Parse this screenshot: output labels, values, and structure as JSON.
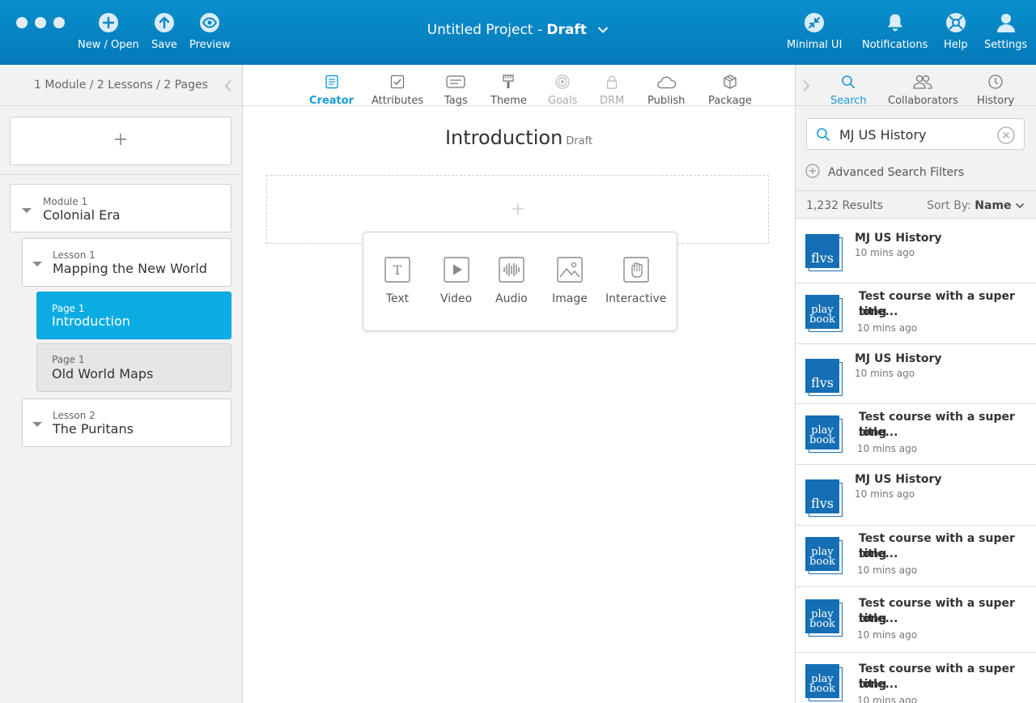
{
  "window": {
    "title": "Untitled Project",
    "title_sep": " - ",
    "status": "Draft"
  },
  "toolbar": {
    "new_open": "New / Open",
    "save": "Save",
    "preview": "Preview",
    "minimal_ui": "Minimal UI",
    "notifications": "Notifications",
    "help": "Help",
    "settings": "Settings"
  },
  "outline": {
    "summary": "1 Module / 2 Lessons / 2 Pages",
    "items": [
      {
        "kind": "Module 1",
        "name": "Colonial Era"
      },
      {
        "kind": "Lesson 1",
        "name": "Mapping the New World"
      },
      {
        "kind": "Page 1",
        "name": "Introduction"
      },
      {
        "kind": "Page 1",
        "name": "Old World Maps"
      },
      {
        "kind": "Lesson 2",
        "name": "The Puritans"
      }
    ]
  },
  "tabs": [
    {
      "label": "Creator"
    },
    {
      "label": "Attributes"
    },
    {
      "label": "Tags"
    },
    {
      "label": "Theme"
    },
    {
      "label": "Goals"
    },
    {
      "label": "DRM"
    },
    {
      "label": "Publish"
    },
    {
      "label": "Package"
    }
  ],
  "page": {
    "title": "Introduction",
    "status": "Draft"
  },
  "insert_menu": [
    {
      "label": "Text"
    },
    {
      "label": "Video"
    },
    {
      "label": "Audio"
    },
    {
      "label": "Image"
    },
    {
      "label": "Interactive"
    }
  ],
  "right_tabs": [
    {
      "label": "Search"
    },
    {
      "label": "Collaborators"
    },
    {
      "label": "History"
    }
  ],
  "search": {
    "value": "MJ US History",
    "advanced": "Advanced Search Filters",
    "count": "1,232 Results",
    "sort_label": "Sort By:",
    "sort_value": "Name"
  },
  "results": [
    {
      "thumb": "flvs",
      "title_1": "MJ US History",
      "title_2": "",
      "time": "10 mins ago"
    },
    {
      "thumb": "playbook",
      "title_1": "Test course with a super long",
      "title_2": "title...",
      "time": "10 mins ago"
    },
    {
      "thumb": "flvs",
      "title_1": "MJ US History",
      "title_2": "",
      "time": "10 mins ago"
    },
    {
      "thumb": "playbook",
      "title_1": "Test course with a super long",
      "title_2": "title...",
      "time": "10 mins ago"
    },
    {
      "thumb": "flvs",
      "title_1": "MJ US History",
      "title_2": "",
      "time": "10 mins ago"
    },
    {
      "thumb": "playbook",
      "title_1": "Test course with a super long",
      "title_2": "title...",
      "time": "10 mins ago"
    },
    {
      "thumb": "playbook",
      "title_1": "Test course with a super long",
      "title_2": "title...",
      "time": "10 mins ago"
    },
    {
      "thumb": "playbook",
      "title_1": "Test course with a super long",
      "title_2": "title...",
      "time": "10 mins ago"
    }
  ],
  "thumb_text": {
    "flvs": "flvs",
    "play": "play",
    "book": "book"
  },
  "colors": {
    "brand_blue": "#0a8ccb",
    "active_item": "#0aace2",
    "accent_text": "#1a9bd7",
    "thumb_blue": "#166fb4"
  },
  "icons": [
    "new-icon",
    "save-icon",
    "preview-icon",
    "minimal-ui-icon",
    "bell-icon",
    "help-icon",
    "settings-icon",
    "search-icon",
    "clear-icon"
  ]
}
